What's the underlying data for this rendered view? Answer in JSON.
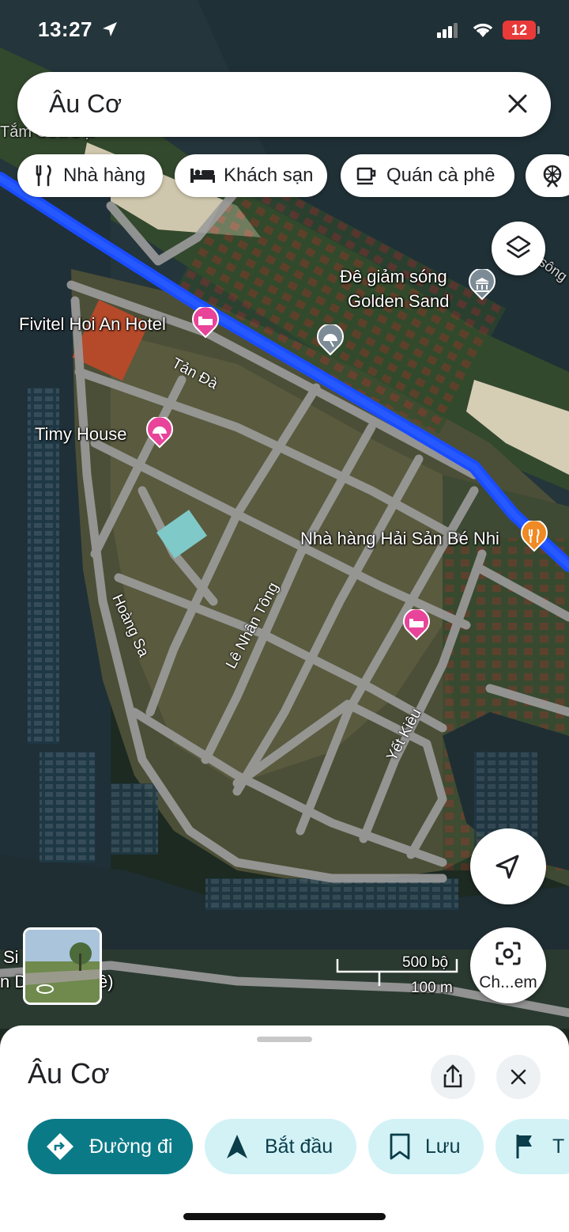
{
  "status_bar": {
    "time": "13:27",
    "battery": "12"
  },
  "search": {
    "query": "Âu Cơ"
  },
  "chips": [
    {
      "label": "Nhà hàng",
      "icon": "restaurant-icon"
    },
    {
      "label": "Khách sạn",
      "icon": "hotel-icon"
    },
    {
      "label": "Quán cà phê",
      "icon": "cafe-icon"
    },
    {
      "label": "",
      "icon": "attraction-icon"
    }
  ],
  "map": {
    "places": [
      {
        "name": "Fivitel Hoi An Hotel",
        "icon": "hotel-icon",
        "color": "#e8449a"
      },
      {
        "name": "Timy House",
        "icon": "beach-icon",
        "color": "#e8449a"
      },
      {
        "name": "Đê giảm sóng",
        "name2": "Golden Sand",
        "icon": "landmark-icon",
        "color": "#7c8b96"
      },
      {
        "name": "Nhà hàng Hải Sản Bé Nhi",
        "icon": "restaurant-icon",
        "color": "#f08a24"
      },
      {
        "name": "",
        "icon": "beach-icon",
        "color": "#7c8b96"
      },
      {
        "name": "",
        "icon": "hotel-icon",
        "color": "#e8449a"
      }
    ],
    "streets": [
      "Tản Đà",
      "Hoàng Sa",
      "Lê Nhân Tông",
      "Yết Kiêu"
    ],
    "partial_labels": [
      "Tắm Cửa Đại",
      "Si",
      "n D",
      "ê)",
      "sông"
    ],
    "scale": {
      "imperial": "500 bộ",
      "metric": "100 m"
    },
    "route_color": "#1a4cff"
  },
  "controls": {
    "layers_icon": "layers-icon",
    "locate_icon": "navigation-arrow-icon",
    "camera_label": "Ch...em"
  },
  "sheet": {
    "title": "Âu Cơ",
    "actions": [
      {
        "label": "Đường đi",
        "icon": "directions-icon",
        "primary": true
      },
      {
        "label": "Bắt đầu",
        "icon": "navigate-icon",
        "primary": false
      },
      {
        "label": "Lưu",
        "icon": "bookmark-icon",
        "primary": false
      },
      {
        "label": "T",
        "icon": "flag-icon",
        "primary": false
      }
    ]
  },
  "colors": {
    "primary_button": "#0b7a87",
    "secondary_button": "#d2f2f6",
    "secondary_text": "#0b3d4a"
  }
}
